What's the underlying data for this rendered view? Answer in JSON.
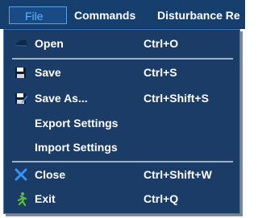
{
  "menubar": {
    "file": "File",
    "commands": "Commands",
    "disturbance": "Disturbance Re"
  },
  "file_menu": {
    "items": [
      {
        "label": "Open",
        "shortcut": "Ctrl+O",
        "icon": "folder-open-icon"
      },
      {
        "label": "Save",
        "shortcut": "Ctrl+S",
        "icon": "floppy-disk-icon"
      },
      {
        "label": "Save As...",
        "shortcut": "Ctrl+Shift+S",
        "icon": "save-as-icon"
      },
      {
        "label": "Export Settings",
        "shortcut": "",
        "icon": ""
      },
      {
        "label": "Import Settings",
        "shortcut": "",
        "icon": ""
      },
      {
        "label": "Close",
        "shortcut": "Ctrl+Shift+W",
        "icon": "close-x-icon"
      },
      {
        "label": "Exit",
        "shortcut": "Ctrl+Q",
        "icon": "exit-runner-icon"
      }
    ]
  },
  "colors": {
    "menubar_bg": "#173f6d",
    "menu_bg": "#1a3c66",
    "menu_border": "#3d79bb",
    "active_text": "#62b4ff",
    "close_icon": "#2f95ff",
    "exit_icon": "#5bbf3c"
  }
}
